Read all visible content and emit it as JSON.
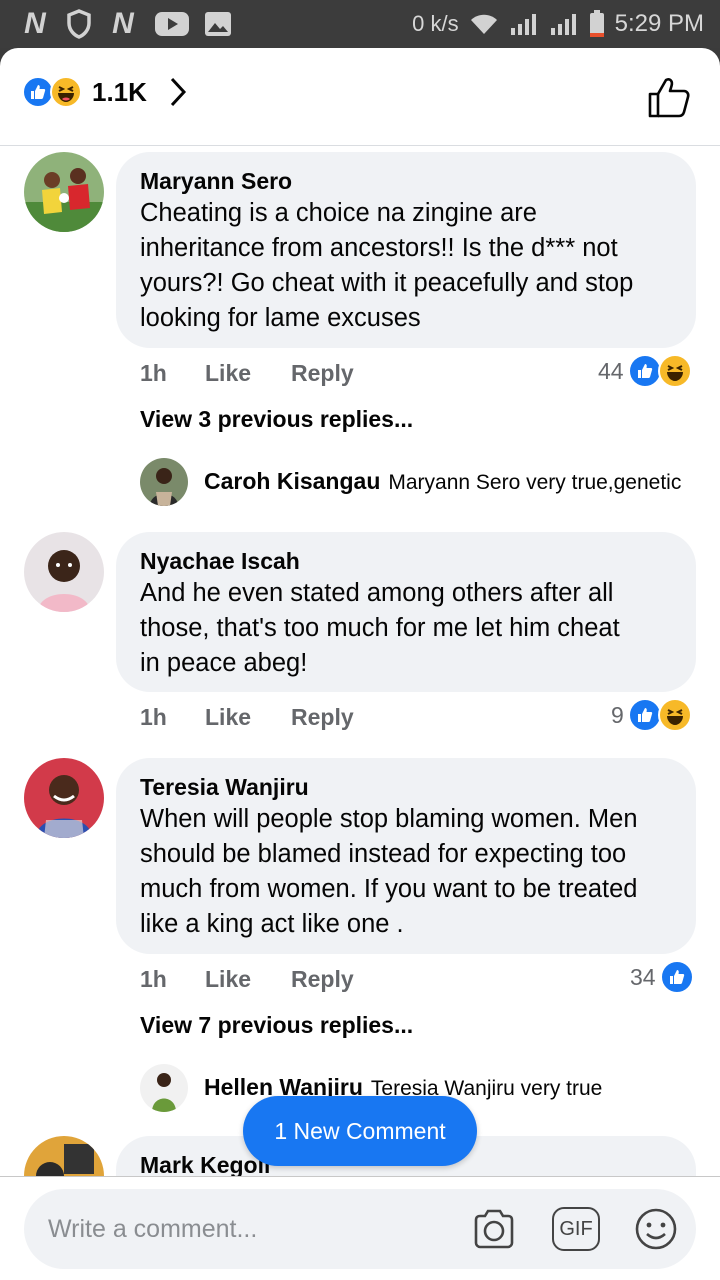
{
  "status_bar": {
    "speed": "0 k/s",
    "time": "5:29 PM",
    "left_icons": [
      "netflix-icon",
      "shield-icon",
      "netflix-icon",
      "youtube-icon",
      "gallery-icon"
    ]
  },
  "header": {
    "reaction_count": "1.1K",
    "reaction_icons": [
      "like-icon",
      "haha-icon"
    ]
  },
  "comments": [
    {
      "author": "Maryann Sero",
      "text_lines": [
        "Cheating is a choice na zingine are",
        "inheritance from ancestors!! Is the d*** not",
        "yours?! Go cheat with it peacefully and stop",
        "looking for lame excuses"
      ],
      "time": "1h",
      "like_label": "Like",
      "reply_label": "Reply",
      "reaction_count": "44",
      "view_replies": "View 3 previous replies...",
      "reply": {
        "author": "Caroh Kisangau",
        "text": "Maryann Sero very true,genetic"
      }
    },
    {
      "author": "Nyachae Iscah",
      "text_lines": [
        "And he  even stated among others after all",
        "those, that's too much for me let him cheat",
        "in peace abeg!"
      ],
      "time": "1h",
      "like_label": "Like",
      "reply_label": "Reply",
      "reaction_count": "9"
    },
    {
      "author": "Teresia Wanjiru",
      "text_lines": [
        "When will people stop blaming women. Men",
        "should be blamed instead for expecting too",
        "much from women. If you want to be treated",
        "like a king act like one ."
      ],
      "time": "1h",
      "like_label": "Like",
      "reply_label": "Reply",
      "reaction_count": "34",
      "view_replies": "View 7 previous replies...",
      "reply": {
        "author": "Hellen Wanjiru",
        "text": "Teresia Wanjiru  very true"
      }
    },
    {
      "author": "Mark Kegoli"
    }
  ],
  "new_comment_label": "1 New Comment",
  "composer": {
    "placeholder": "Write a comment...",
    "icons": [
      "camera-icon",
      "gif-icon",
      "emoji-icon"
    ],
    "gif_label": "GIF"
  },
  "colors": {
    "accent": "#1877f2",
    "haha": "#f7b928",
    "bubble": "#f0f2f5",
    "secondary_text": "#65676b"
  }
}
